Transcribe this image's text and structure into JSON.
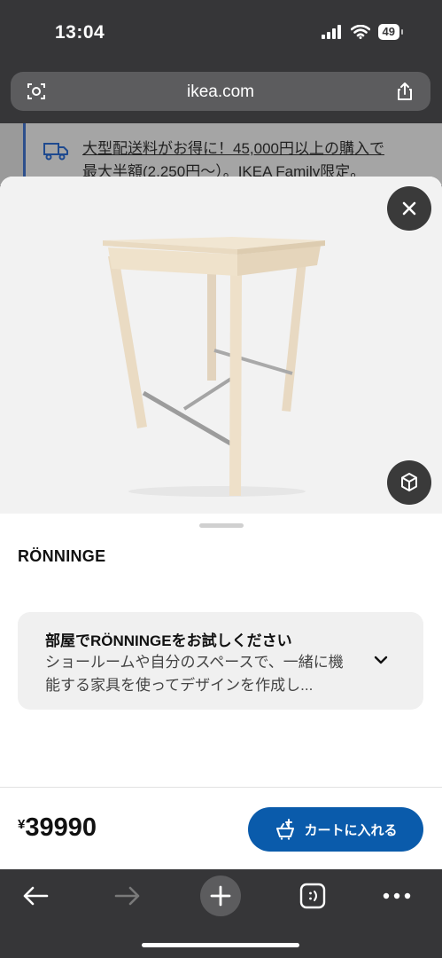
{
  "status": {
    "time": "13:04",
    "battery": "49"
  },
  "browser": {
    "url": "ikea.com"
  },
  "banner": {
    "line1": "大型配送料がお得に！45,000円以上の購入で",
    "line2": "最大半額(2,250円〜）。IKEA Family限定。"
  },
  "product": {
    "name": "RÖNNINGE",
    "currency": "¥",
    "price": "39990",
    "add_to_cart_label": "カートに入れる"
  },
  "try_card": {
    "title": "部屋でRÖNNINGEをお試しください",
    "description": "ショールームや自分のスペースで、一緒に機能する家具を使ってデザインを作成し..."
  },
  "colors": {
    "accent": "#0a5bab",
    "chrome": "#363638"
  },
  "icons": [
    "camera-scan-icon",
    "share-icon",
    "truck-icon",
    "close-icon",
    "ar-cube-icon",
    "chevron-down-icon",
    "cart-add-icon",
    "back-icon",
    "forward-icon",
    "new-tab-icon",
    "tabs-icon",
    "more-icon"
  ]
}
